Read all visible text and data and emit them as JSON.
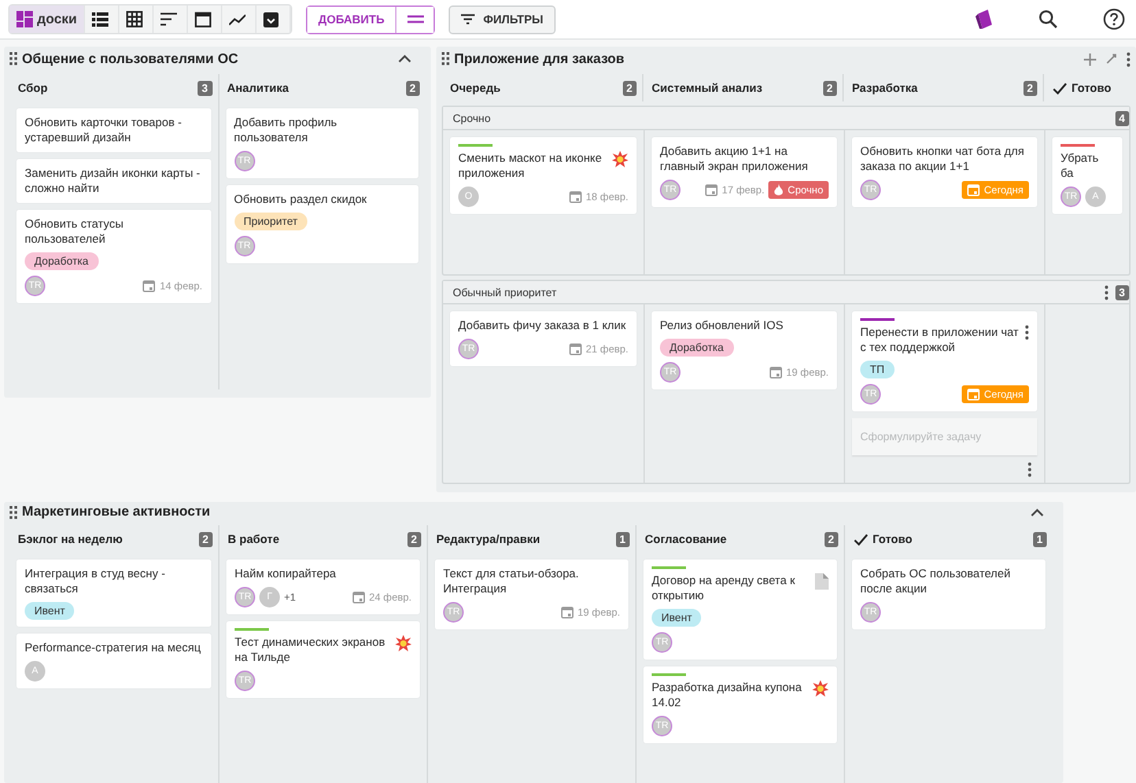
{
  "toolbar": {
    "views": [
      {
        "kind": "boards",
        "label": "доски",
        "selected": true
      },
      {
        "kind": "list",
        "selected": false
      },
      {
        "kind": "table",
        "selected": false
      },
      {
        "kind": "sort",
        "selected": false
      },
      {
        "kind": "calendar",
        "selected": false
      },
      {
        "kind": "chart",
        "selected": false
      },
      {
        "kind": "archive",
        "selected": false
      }
    ],
    "add_button": "ДОБАВИТЬ",
    "filter_button": "ФИЛЬТРЫ"
  },
  "boards": [
    {
      "title": "Общение с пользователями ОС",
      "expanded": true,
      "columns": [
        {
          "title": "Сбор",
          "count": "3",
          "done": false
        },
        {
          "title": "Аналитика",
          "count": "2",
          "done": false
        }
      ],
      "lanes": [
        {
          "cells": [
            {
              "cards": [
                {
                  "title": "Обновить карточки товаров - устаревший дизайн"
                },
                {
                  "title": "Заменить дизайн иконки карты - сложно найти"
                },
                {
                  "title": "Обновить статусы пользователей",
                  "tags": [
                    {
                      "label": "Доработка",
                      "color": "#f8c3d6"
                    }
                  ],
                  "people": [
                    {
                      "initials": "TR",
                      "ring": true
                    }
                  ],
                  "date": "14 февр."
                }
              ]
            },
            {
              "cards": [
                {
                  "title": "Добавить профиль пользователя",
                  "people": [
                    {
                      "initials": "TR",
                      "ring": true
                    }
                  ]
                },
                {
                  "title": "Обновить раздел скидок",
                  "tags": [
                    {
                      "label": "Приоритет",
                      "color": "#fde3b8"
                    }
                  ],
                  "people": [
                    {
                      "initials": "TR",
                      "ring": true
                    }
                  ]
                }
              ]
            }
          ]
        }
      ]
    },
    {
      "title": "Приложение для заказов",
      "actions": true,
      "columns": [
        {
          "title": "Очередь",
          "count": "2",
          "done": false
        },
        {
          "title": "Системный анализ",
          "count": "2",
          "done": false
        },
        {
          "title": "Разработка",
          "count": "2",
          "done": false
        },
        {
          "title": "Готово",
          "done": true
        }
      ],
      "lanes": [
        {
          "title": "Срочно",
          "count": "4",
          "menu": false,
          "cells": [
            {
              "cards": [
                {
                  "title": "Сменить маскот на иконке приложения",
                  "color": "#7cc84a",
                  "kind": "burst",
                  "people": [
                    {
                      "initials": "О",
                      "ring": false
                    }
                  ],
                  "date": "18 февр."
                }
              ]
            },
            {
              "cards": [
                {
                  "title": "Добавить акцию 1+1 на главный экран приложения",
                  "people": [
                    {
                      "initials": "TR",
                      "ring": true
                    }
                  ],
                  "date": "17 февр.",
                  "badge": {
                    "kind": "urgent",
                    "label": "Срочно"
                  }
                }
              ]
            },
            {
              "cards": [
                {
                  "title": "Обновить кнопки чат бота для заказа по акции 1+1",
                  "people": [
                    {
                      "initials": "TR",
                      "ring": true
                    }
                  ],
                  "badge": {
                    "kind": "today",
                    "label": "Сегодня"
                  }
                }
              ]
            },
            {
              "cards": [
                {
                  "title": "Убрать ба",
                  "color": "#e85a5c",
                  "people": [
                    {
                      "initials": "TR",
                      "ring": true
                    },
                    {
                      "initials": "A",
                      "ring": false
                    }
                  ]
                }
              ]
            }
          ]
        },
        {
          "title": "Обычный приоритет",
          "count": "3",
          "menu": true,
          "cells": [
            {
              "cards": [
                {
                  "title": "Добавить фичу заказа в 1 клик",
                  "people": [
                    {
                      "initials": "TR",
                      "ring": true
                    }
                  ],
                  "date": "21 февр."
                }
              ]
            },
            {
              "cards": [
                {
                  "title": "Релиз обновлений IOS",
                  "tags": [
                    {
                      "label": "Доработка",
                      "color": "#f8c3d6"
                    }
                  ],
                  "people": [
                    {
                      "initials": "TR",
                      "ring": true
                    }
                  ],
                  "date": "19 февр."
                }
              ]
            },
            {
              "cards": [
                {
                  "title": "Перенести в приложении чат с тех поддержкой",
                  "color": "#9c27b0",
                  "menu": true,
                  "tags": [
                    {
                      "label": "ТП",
                      "color": "#bdebf3"
                    }
                  ],
                  "people": [
                    {
                      "initials": "TR",
                      "ring": true
                    }
                  ],
                  "badge": {
                    "kind": "today",
                    "label": "Сегодня"
                  }
                }
              ],
              "placeholder": "Сформулируйте задачу",
              "menu": true
            },
            {}
          ]
        }
      ]
    },
    {
      "title": "Маркетинговые активности",
      "expanded": true,
      "columns": [
        {
          "title": "Бэклог на неделю",
          "count": "2",
          "done": false
        },
        {
          "title": "В работе",
          "count": "2",
          "done": false
        },
        {
          "title": "Редактура/правки",
          "count": "1",
          "done": false
        },
        {
          "title": "Согласование",
          "count": "2",
          "done": false
        },
        {
          "title": "Готово",
          "count": "1",
          "done": true
        }
      ],
      "lanes": [
        {
          "cells": [
            {
              "cards": [
                {
                  "title": "Интеграция в студ весну - связаться",
                  "tags": [
                    {
                      "label": "Ивент",
                      "color": "#bdebf3"
                    }
                  ]
                },
                {
                  "title": "Performance-стратегия на месяц",
                  "people": [
                    {
                      "initials": "A",
                      "ring": false
                    }
                  ]
                }
              ]
            },
            {
              "cards": [
                {
                  "title": "Найм копирайтера",
                  "people": [
                    {
                      "initials": "TR",
                      "ring": true
                    },
                    {
                      "initials": "Г",
                      "ring": false
                    }
                  ],
                  "more": "+1",
                  "date": "24 февр."
                },
                {
                  "title": "Тест динамических экранов на Тильде",
                  "color": "#7cc84a",
                  "kind": "burst",
                  "people": [
                    {
                      "initials": "TR",
                      "ring": true
                    }
                  ]
                }
              ]
            },
            {
              "cards": [
                {
                  "title": "Текст для статьи-обзора. Интеграция",
                  "people": [
                    {
                      "initials": "TR",
                      "ring": true
                    }
                  ],
                  "date": "19 февр."
                }
              ]
            },
            {
              "cards": [
                {
                  "title": "Договор на аренду света к открытию",
                  "color": "#7cc84a",
                  "kind": "file",
                  "tags": [
                    {
                      "label": "Ивент",
                      "color": "#bdebf3"
                    }
                  ],
                  "people": [
                    {
                      "initials": "TR",
                      "ring": true
                    }
                  ]
                },
                {
                  "title": "Разработка дизайна купона 14.02",
                  "color": "#7cc84a",
                  "kind": "burst",
                  "people": [
                    {
                      "initials": "TR",
                      "ring": true
                    }
                  ]
                }
              ]
            },
            {
              "cards": [
                {
                  "title": "Собрать ОС пользователей после акции",
                  "people": [
                    {
                      "initials": "TR",
                      "ring": true
                    }
                  ]
                }
              ]
            }
          ]
        }
      ]
    }
  ]
}
